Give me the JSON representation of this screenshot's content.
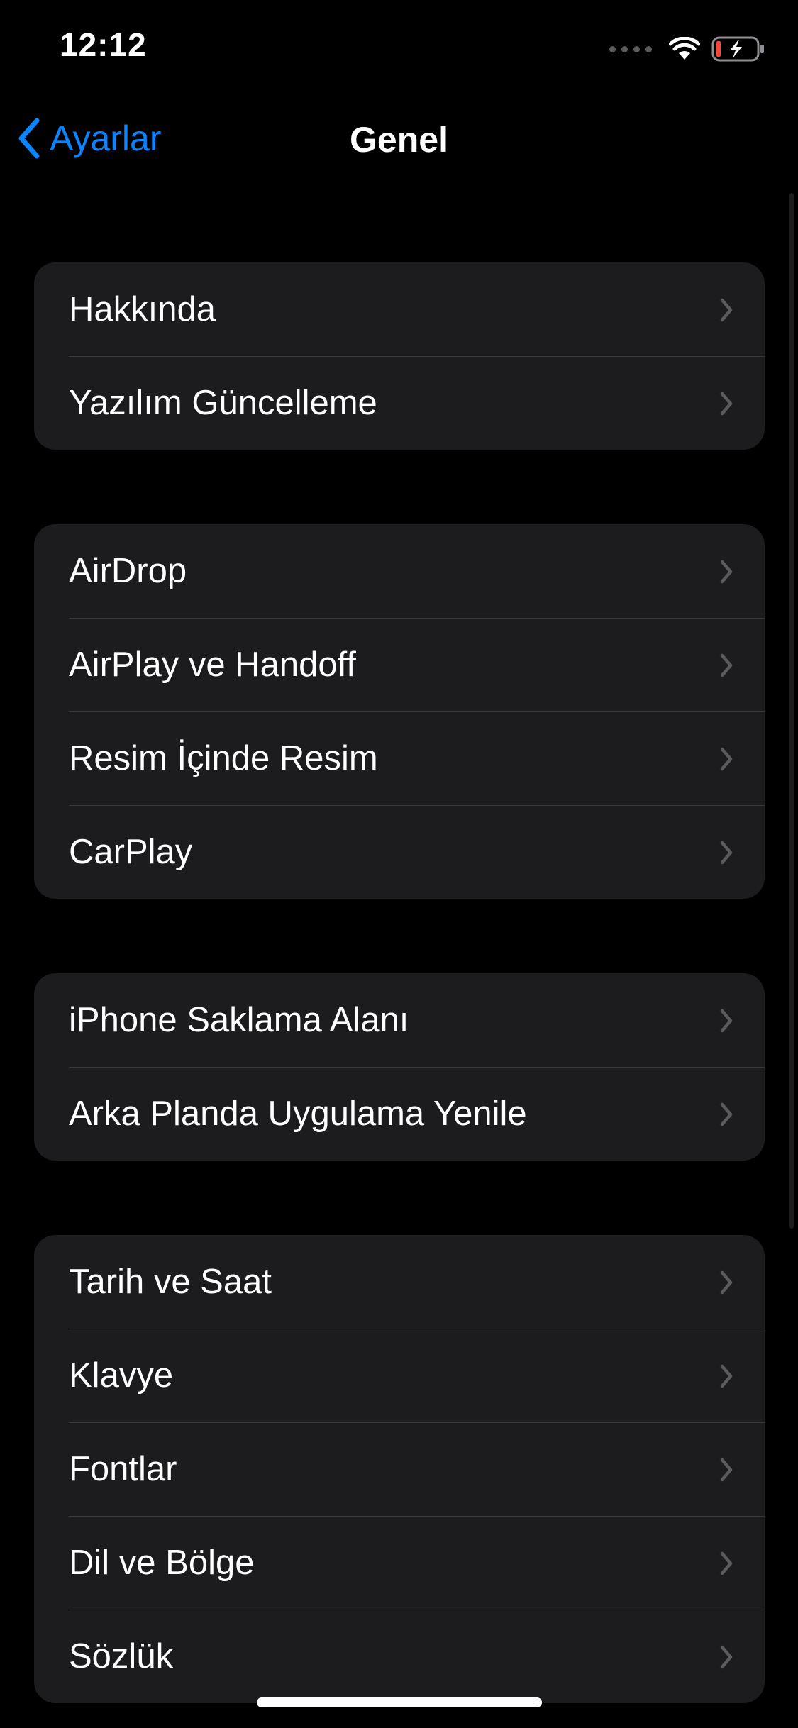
{
  "status_bar": {
    "time": "12:12",
    "icons": [
      "signal-dots-icon",
      "wifi-icon",
      "battery-charging-icon"
    ],
    "battery_low_color": "#ff453a"
  },
  "nav": {
    "back_label": "Ayarlar",
    "title": "Genel",
    "accent_color": "#0a84ff"
  },
  "groups": [
    {
      "items": [
        {
          "label": "Hakkında"
        },
        {
          "label": "Yazılım Güncelleme"
        }
      ]
    },
    {
      "items": [
        {
          "label": "AirDrop"
        },
        {
          "label": "AirPlay ve Handoff"
        },
        {
          "label": "Resim İçinde Resim"
        },
        {
          "label": "CarPlay"
        }
      ]
    },
    {
      "items": [
        {
          "label": "iPhone Saklama Alanı"
        },
        {
          "label": "Arka Planda Uygulama Yenile"
        }
      ]
    },
    {
      "items": [
        {
          "label": "Tarih ve Saat"
        },
        {
          "label": "Klavye"
        },
        {
          "label": "Fontlar"
        },
        {
          "label": "Dil ve Bölge"
        },
        {
          "label": "Sözlük"
        }
      ]
    }
  ]
}
